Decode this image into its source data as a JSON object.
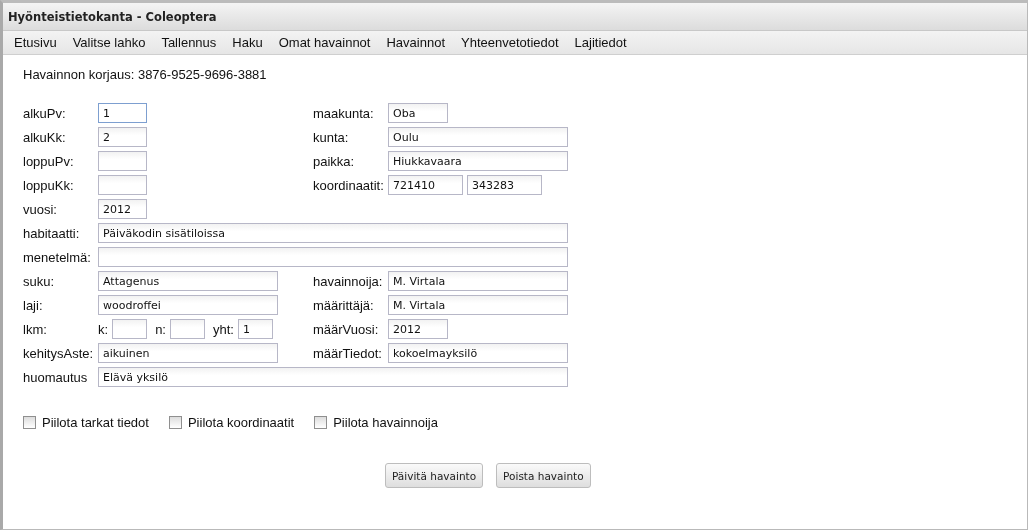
{
  "window": {
    "title": "Hyönteistietokanta - Coleoptera"
  },
  "menu": [
    {
      "label": "Etusivu"
    },
    {
      "label": "Valitse lahko"
    },
    {
      "label": "Tallennus"
    },
    {
      "label": "Haku"
    },
    {
      "label": "Omat havainnot"
    },
    {
      "label": "Havainnot"
    },
    {
      "label": "Yhteenvetotiedot"
    },
    {
      "label": "Lajitiedot"
    }
  ],
  "heading": "Havainnon korjaus: 3876-9525-9696-3881",
  "rows": [
    {
      "cells": [
        {
          "label": "alkuPv:",
          "kind": "tiny",
          "inputs": [
            {
              "value": "1",
              "focused": true
            }
          ]
        },
        {
          "label": "maakunta:",
          "kind": "small",
          "inputs": [
            {
              "value": "Oba",
              "focused": false
            }
          ]
        }
      ]
    },
    {
      "cells": [
        {
          "label": "alkuKk:",
          "kind": "tiny",
          "inputs": [
            {
              "value": "2",
              "focused": false
            }
          ]
        },
        {
          "label": "kunta:",
          "kind": "medium",
          "inputs": [
            {
              "value": "Oulu",
              "focused": false
            }
          ]
        }
      ]
    },
    {
      "cells": [
        {
          "label": "loppuPv:",
          "kind": "tiny",
          "inputs": [
            {
              "focused": false
            }
          ]
        },
        {
          "label": "paikka:",
          "kind": "medium",
          "inputs": [
            {
              "value": "Hiukkavaara",
              "focused": false
            }
          ]
        }
      ]
    },
    {
      "cells": [
        {
          "label": "loppuKk:",
          "kind": "tiny",
          "inputs": [
            {
              "focused": false
            }
          ]
        },
        {
          "label": "koordinaatit:",
          "kind": "pair",
          "inputs": [
            {
              "value": "721410",
              "focused": false
            },
            {
              "value": "343283",
              "focused": false
            }
          ]
        }
      ]
    },
    {
      "cells": [
        {
          "label": "vuosi:",
          "kind": "tiny",
          "inputs": [
            {
              "value": "2012",
              "focused": false
            }
          ]
        }
      ]
    },
    {
      "cells": [
        {
          "label": "habitaatti:",
          "kind": "wide",
          "inputs": [
            {
              "value": "Päiväkodin sisätiloissa",
              "focused": false
            }
          ]
        }
      ]
    },
    {
      "cells": [
        {
          "label": "menetelmä:",
          "kind": "wide",
          "inputs": [
            {
              "focused": false
            }
          ]
        }
      ]
    },
    {
      "cells": [
        {
          "label": "suku:",
          "kind": "medium",
          "inputs": [
            {
              "value": "Attagenus",
              "focused": false
            }
          ]
        },
        {
          "label": "havainnoija:",
          "kind": "medium",
          "inputs": [
            {
              "value": "M. Virtala",
              "focused": false
            }
          ]
        }
      ]
    },
    {
      "cells": [
        {
          "label": "laji:",
          "kind": "medium",
          "inputs": [
            {
              "value": "woodroffei",
              "focused": false
            }
          ]
        },
        {
          "label": "määrittäjä:",
          "kind": "medium",
          "inputs": [
            {
              "value": "M. Virtala",
              "focused": false
            }
          ]
        }
      ]
    },
    {
      "cells": [
        {
          "label": "lkm:",
          "kind": "count",
          "inputs": [
            {
              "label": "k:",
              "focused": false
            },
            {
              "label": "n:",
              "focused": false
            },
            {
              "label": "yht:",
              "value": "1",
              "focused": false
            }
          ]
        },
        {
          "label": "määrVuosi:",
          "kind": "small",
          "inputs": [
            {
              "value": "2012",
              "focused": false
            }
          ]
        }
      ]
    },
    {
      "cells": [
        {
          "label": "kehitysAste:",
          "kind": "medium",
          "inputs": [
            {
              "value": "aikuinen",
              "focused": false
            }
          ]
        },
        {
          "label": "määrTiedot:",
          "kind": "medium",
          "inputs": [
            {
              "value": "kokoelmayksilö",
              "focused": false
            }
          ]
        }
      ]
    },
    {
      "cells": [
        {
          "label": "huomautus",
          "kind": "wide",
          "inputs": [
            {
              "value": "Elävä yksilö",
              "focused": false
            }
          ]
        }
      ]
    }
  ],
  "checkboxes": [
    {
      "label": "Piilota tarkat tiedot",
      "checked": false
    },
    {
      "label": "Piilota koordinaatit",
      "checked": false
    },
    {
      "label": "Piilota havainnoija",
      "checked": false
    }
  ],
  "buttons": [
    "Päivitä havainto",
    "Poista havainto"
  ]
}
